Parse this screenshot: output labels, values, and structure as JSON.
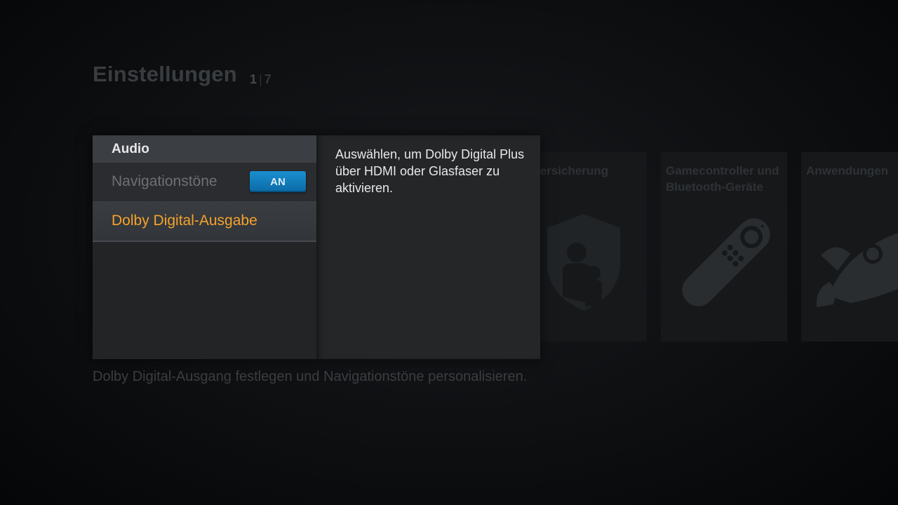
{
  "header": {
    "title": "Einstellungen",
    "pager": {
      "current": "1",
      "total": "7"
    }
  },
  "background_cards": [
    {
      "label": "Kindersicherung",
      "visible_label": "ndersicherung",
      "icon": "parental-shield-icon"
    },
    {
      "label": "Gamecontroller und Bluetooth-Geräte",
      "icon": "remote-control-icon"
    },
    {
      "label": "Anwendungen",
      "icon": "rocket-icon"
    }
  ],
  "dialog": {
    "section_title": "Audio",
    "items": [
      {
        "label": "Navigationstöne",
        "toggle": "AN"
      },
      {
        "label": "Dolby Digital-Ausgabe",
        "selected": true
      }
    ],
    "description": "Auswählen, um Dolby Digital Plus über HDMI oder Glasfaser zu aktivieren."
  },
  "footer": {
    "hint": "Dolby Digital-Ausgang festlegen und Navigationstöne personalisieren."
  },
  "colors": {
    "accent_selected": "#f4a32c",
    "toggle_on": "#1b8fd0"
  }
}
